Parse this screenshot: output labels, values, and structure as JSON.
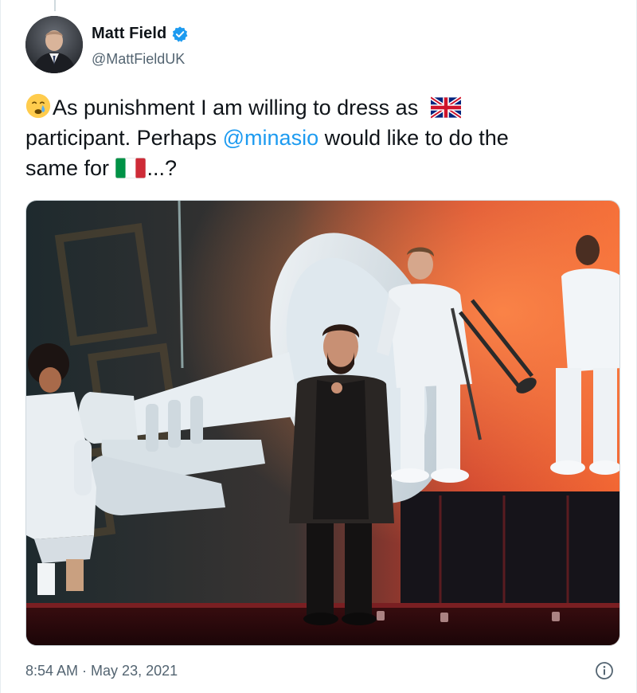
{
  "author": {
    "display_name": "Matt Field",
    "handle": "@MattFieldUK",
    "verified": true,
    "avatar_icon": "profile-photo"
  },
  "tweet": {
    "line1_text": "As punishment I am willing to dress as",
    "line2_prefix": "participant. Perhaps ",
    "mention": "@minasio",
    "line2_suffix": " would like to do the",
    "line3_prefix": "same for ",
    "line3_suffix": "...?",
    "emojis": [
      "crying-face-emoji",
      "uk-flag-emoji",
      "italy-flag-emoji"
    ]
  },
  "media": {
    "icon": "photo-stage-performance"
  },
  "meta": {
    "time": "8:54 AM",
    "separator": " · ",
    "date": "May 23, 2021"
  },
  "colors": {
    "mention": "#1d9bf0",
    "verified": "#1d9bf0",
    "muted": "#536471"
  }
}
